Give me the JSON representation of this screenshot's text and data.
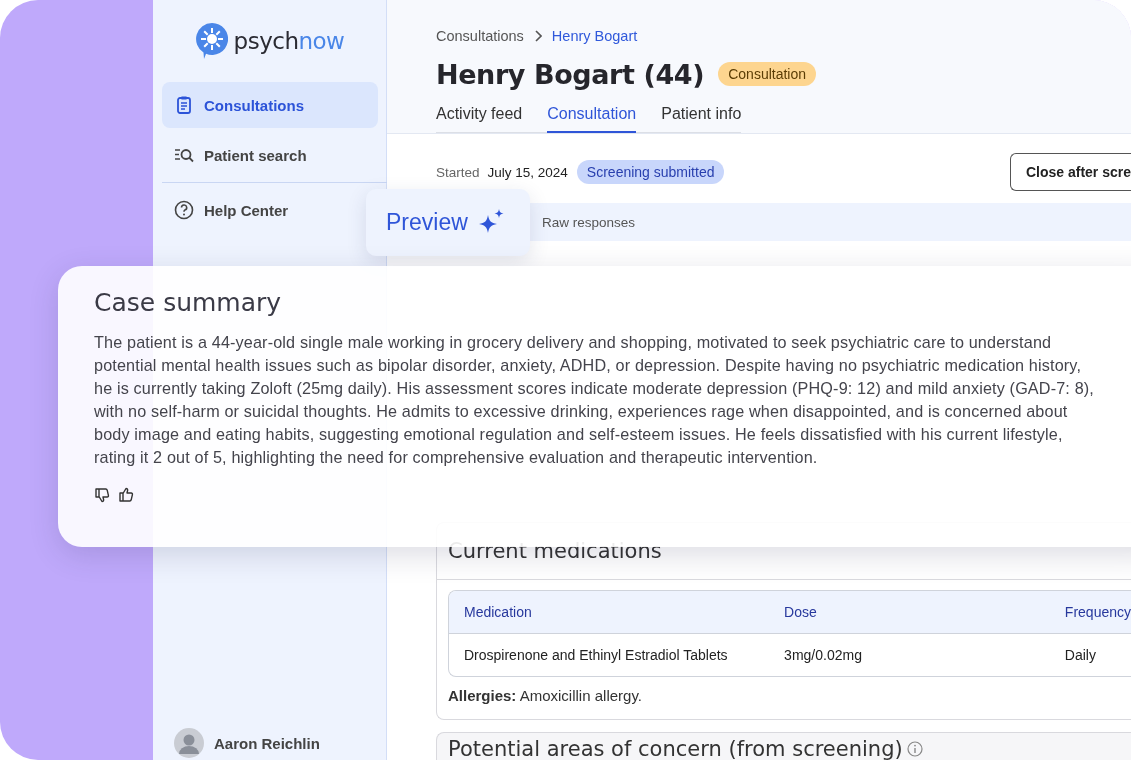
{
  "logo": {
    "text": "psych",
    "accent": "now"
  },
  "sidebar": {
    "items": [
      {
        "label": "Consultations",
        "selected": true
      },
      {
        "label": "Patient search",
        "selected": false
      },
      {
        "label": "Help Center",
        "selected": false
      }
    ],
    "user": {
      "name": "Aaron Reichlin"
    }
  },
  "breadcrumb": [
    "Consultations",
    "Henry Bogart"
  ],
  "title": "Henry Bogart (44)",
  "title_badge": "Consultation",
  "tabs": [
    {
      "label": "Activity feed",
      "selected": false
    },
    {
      "label": "Consultation",
      "selected": true
    },
    {
      "label": "Patient info",
      "selected": false
    }
  ],
  "started_label": "Started",
  "started_date": "July 15, 2024",
  "status_badge": "Screening submitted",
  "close_button": "Close after scre",
  "subtabs": [
    {
      "label": "Preview",
      "selected": true
    },
    {
      "label": "Raw responses",
      "selected": false
    }
  ],
  "case_summary": {
    "title": "Case summary",
    "text": "The patient is a 44-year-old single male working in grocery delivery and shopping, motivated to seek psychiatric care to understand potential mental health issues such as bipolar disorder, anxiety, ADHD, or depression. Despite having no psychiatric medication history, he is currently taking Zoloft (25mg daily). His assessment scores indicate moderate depression (PHQ-9: 12) and mild anxiety (GAD-7: 8), with no self-harm or suicidal thoughts. He admits to excessive drinking, experiences rage when disappointed, and is concerned about body image and eating habits, suggesting emotional regulation and self-esteem issues. He feels dissatisfied with his current lifestyle, rating it 2 out of 5, highlighting the need for comprehensive evaluation and therapeutic intervention."
  },
  "medications": {
    "title": "Current medications",
    "columns": [
      "Medication",
      "Dose",
      "Frequency"
    ],
    "rows": [
      [
        "Drospirenone and Ethinyl Estradiol Tablets",
        "3mg/0.02mg",
        "Daily"
      ]
    ],
    "allergies": "**Allergies:** Amoxicillin allergy."
  },
  "concerns": {
    "title": "Potential areas of concern (from screening)"
  }
}
